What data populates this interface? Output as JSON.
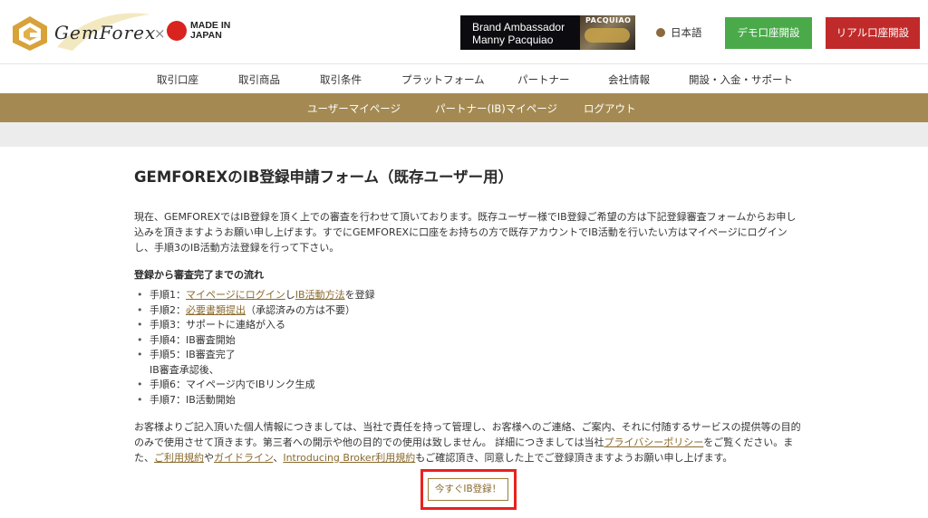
{
  "header": {
    "logo_text": "GemForex",
    "logo_x": "×",
    "made_in_line1": "MADE IN",
    "made_in_line2": "JAPAN",
    "ambassador_line1": "Brand Ambassador",
    "ambassador_line2": "Manny Pacquiao",
    "ambassador_photo_label": "PACQUIAO",
    "language": "日本語",
    "demo_button": "デモ口座開設",
    "real_button": "リアル口座開設"
  },
  "main_nav": [
    "取引口座",
    "取引商品",
    "取引条件",
    "プラットフォーム",
    "パートナー",
    "会社情報",
    "開設・入金・サポート"
  ],
  "sub_nav": [
    "ユーザーマイページ",
    "パートナー(IB)マイページ",
    "ログアウト"
  ],
  "page": {
    "title": "GEMFOREXのIB登録申請フォーム（既存ユーザー用）",
    "intro": "現在、GEMFOREXではIB登録を頂く上での審査を行わせて頂いております。既存ユーザー様でIB登録ご希望の方は下記登録審査フォームからお申し込みを頂きますようお願い申し上げます。すでにGEMFOREXに口座をお持ちの方で既存アカウントでIB活動を行いたい方はマイページにログインし、手順3のIB活動方法登録を行って下さい。",
    "flow_heading": "登録から審査完了までの流れ",
    "steps": {
      "s1_prefix": "手順1：",
      "s1_link1": "マイページにログイン",
      "s1_mid": "し",
      "s1_link2": "IB活動方法",
      "s1_suffix": "を登録",
      "s2_prefix": "手順2：",
      "s2_link": "必要書類提出",
      "s2_suffix": "（承認済みの方は不要）",
      "s3": "手順3：サポートに連絡が入る",
      "s4": "手順4：IB審査開始",
      "s5": "手順5：IB審査完了",
      "s5_note": "IB審査承認後、",
      "s6": "手順6：マイページ内でIBリンク生成",
      "s7": "手順7：IB活動開始"
    },
    "privacy": {
      "t1": "お客様よりご記入頂いた個人情報につきましては、当社で責任を持って管理し、お客様へのご連絡、ご案内、それに付随するサービスの提供等の目的のみで使用させて頂きます。第三者への開示や他の目的での使用は致しません。 詳細につきましては当社",
      "link_privacy": "プライバシーポリシー",
      "t2": "をご覧ください。また、",
      "link_terms": "ご利用規約",
      "t3": "や",
      "link_guideline": "ガイドライン",
      "t4": "、",
      "link_ib_terms": "Introducing Broker利用規約",
      "t5": "もご確認頂き、同意した上でご登録頂きますようお願い申し上げます。"
    },
    "cta_button": "今すぐIB登録！"
  },
  "colors": {
    "gold_bar": "#a48a52",
    "demo_green": "#4aaa4a",
    "real_red": "#c02a2a",
    "link": "#8a6a2e",
    "highlight_red": "#e8221e"
  }
}
